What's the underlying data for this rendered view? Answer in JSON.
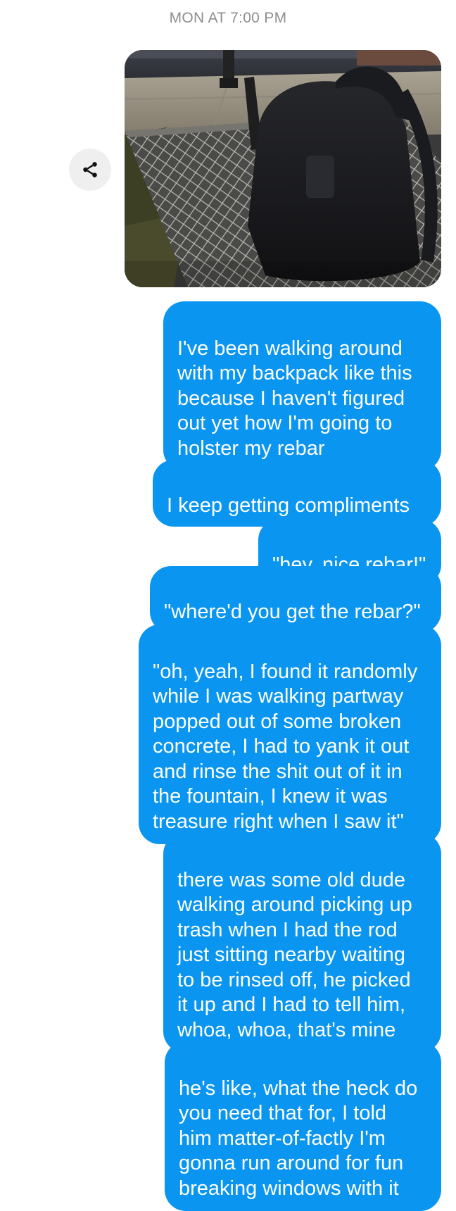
{
  "conversation": {
    "timestamp": "MON AT 7:00 PM",
    "photo_message": {
      "share_icon": "share-icon",
      "description_icon": "photo-attachment"
    },
    "messages": [
      {
        "text": "I've been walking around\nwith my backpack like this\nbecause I haven't figured\nout yet how I'm going to\nholster my rebar"
      },
      {
        "text": "I keep getting compliments"
      },
      {
        "text": "\"hey, nice rebar!\""
      },
      {
        "text": "\"where'd you get the rebar?\""
      },
      {
        "text": "\"oh, yeah, I found it randomly\nwhile I was walking partway\npopped out of some broken\nconcrete, I had to yank it out\nand rinse the shit out of it in\nthe fountain, I knew it was\ntreasure right when I saw it\""
      },
      {
        "text": "there was some old dude\nwalking around picking up\ntrash when I had the rod\njust sitting nearby waiting\nto be rinsed off, he picked\nit up and I had to tell him,\nwhoa, whoa, that's mine"
      },
      {
        "text": "he's like, what the heck do\nyou need that for, I told\nhim matter-of-factly I'm\ngonna run around for fun\nbreaking windows with it"
      }
    ],
    "colors": {
      "outgoing_bubble": "#0a95f0",
      "timestamp": "#8e8e8e",
      "share_button_bg": "#efefef"
    }
  }
}
